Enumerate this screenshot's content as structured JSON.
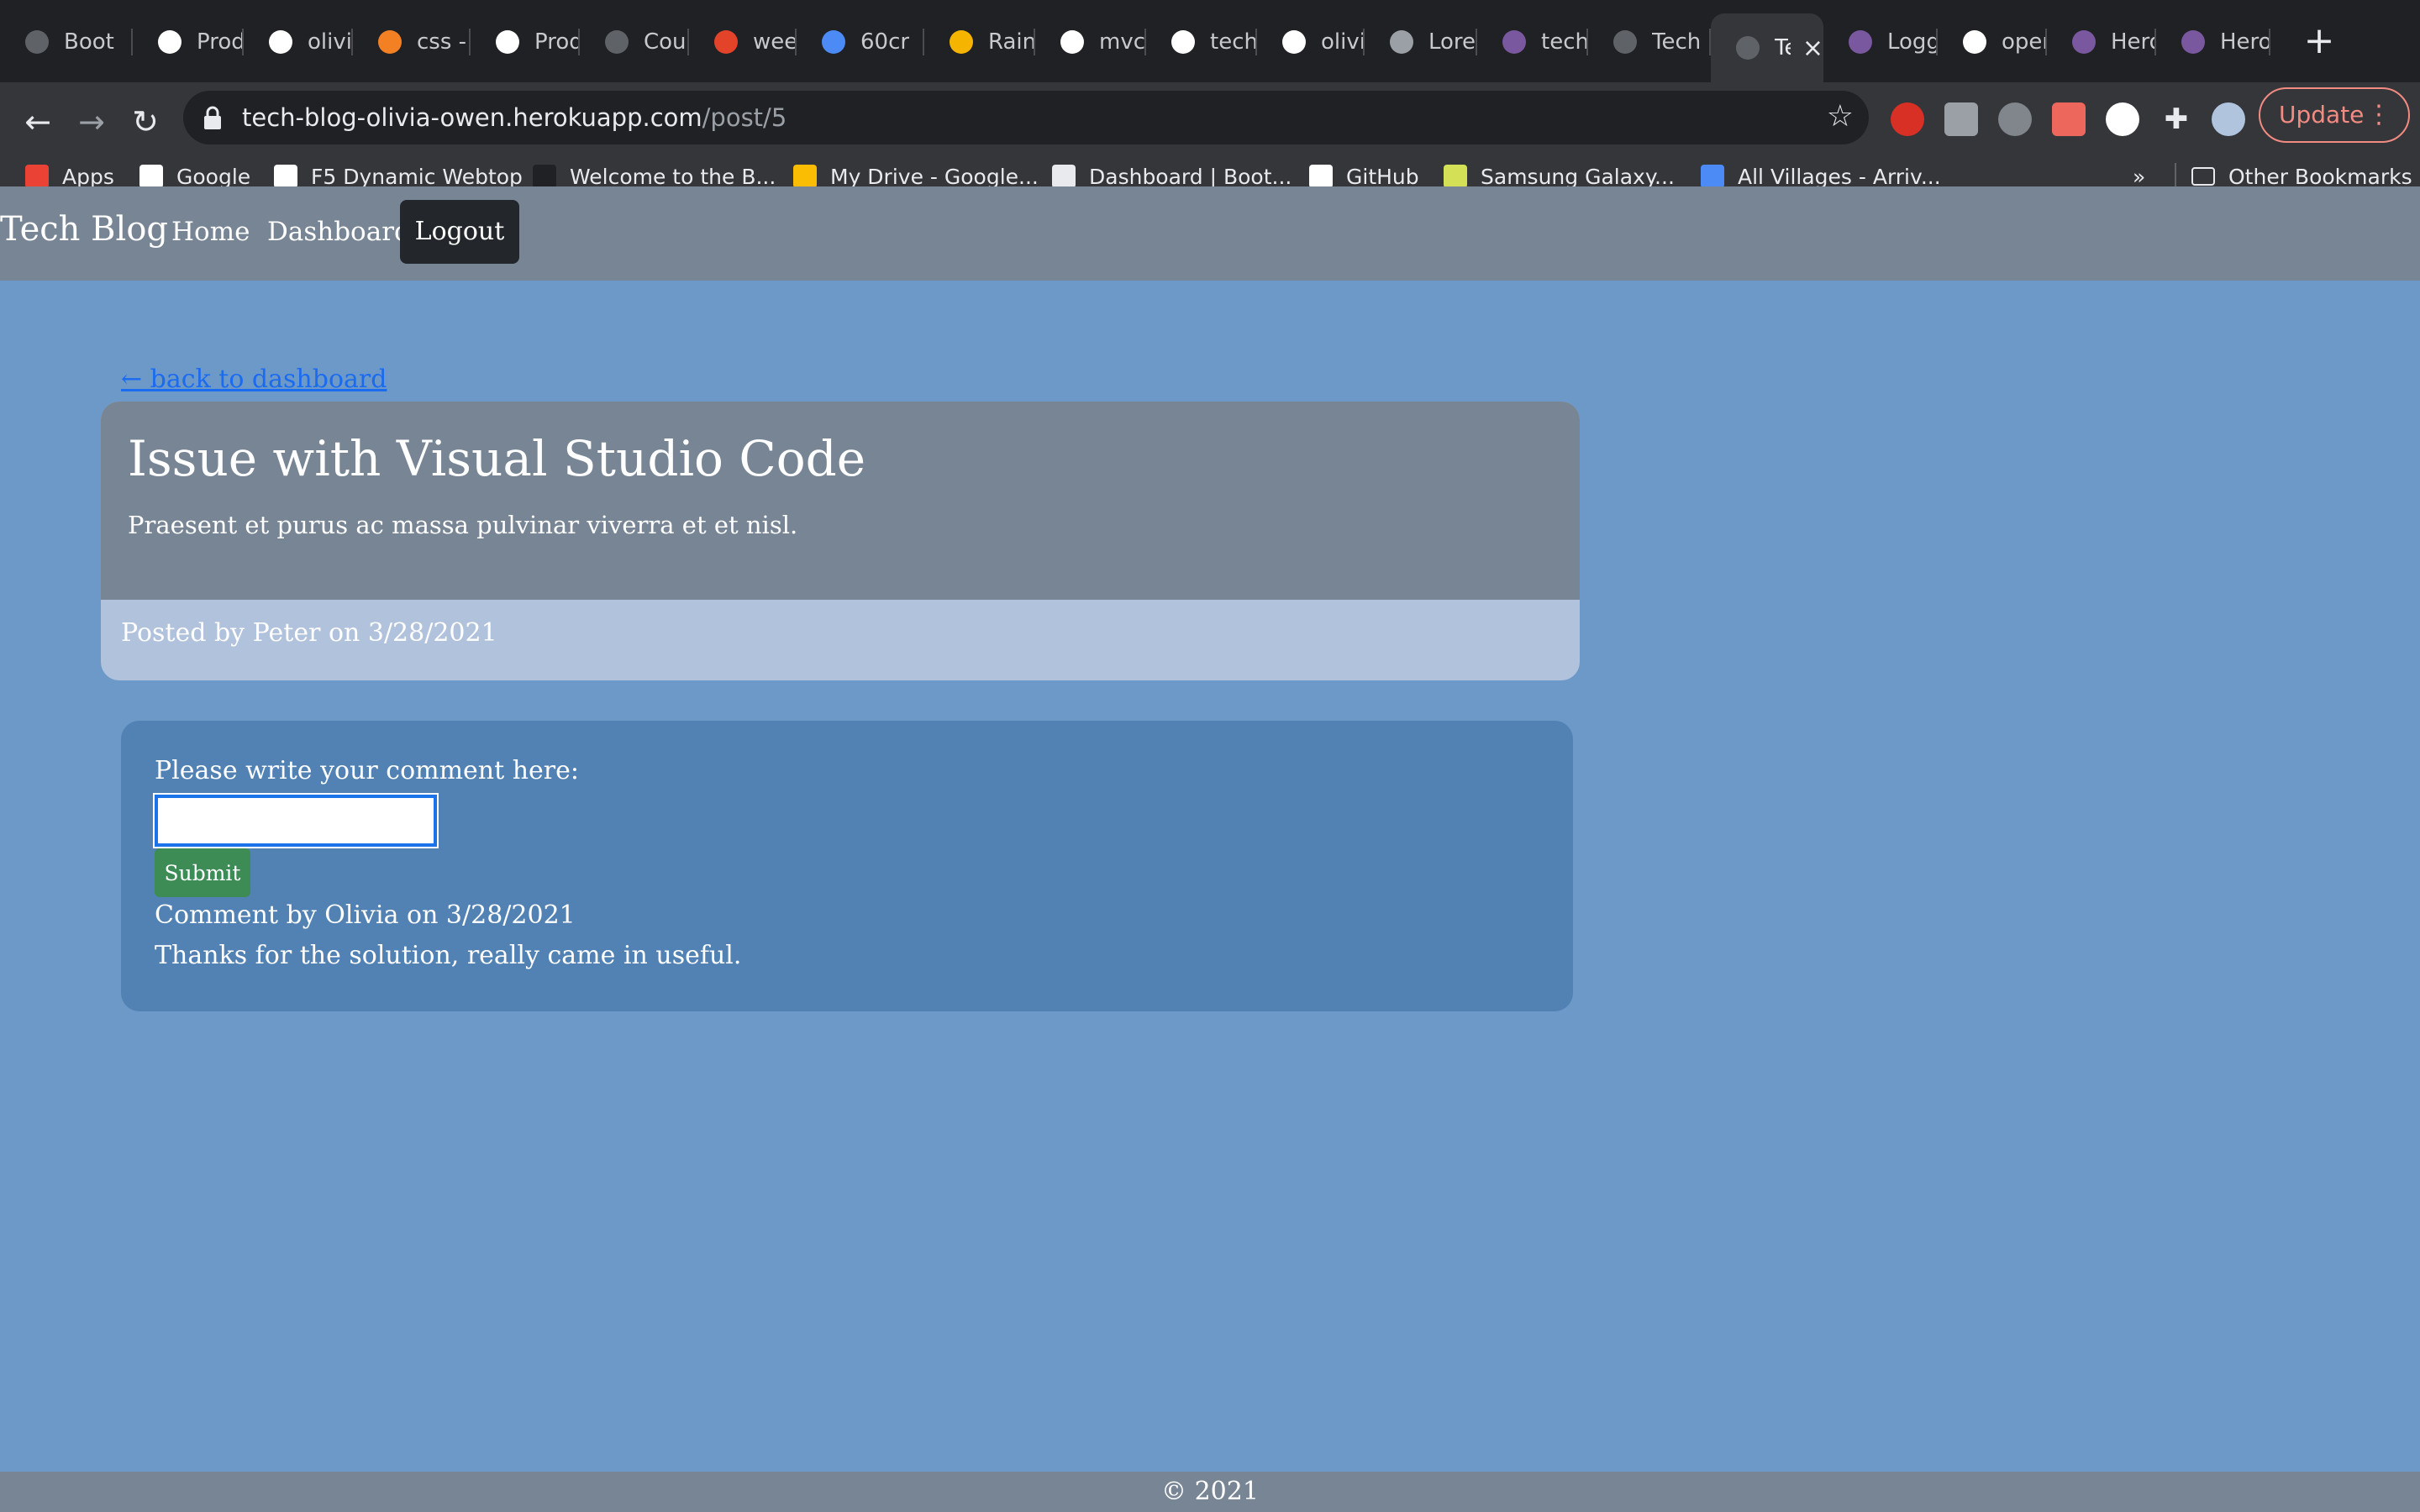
{
  "browser": {
    "tabs": [
      {
        "label": "Boot",
        "icon": "globe-icon",
        "color": "#5f6368"
      },
      {
        "label": "Prod",
        "icon": "page-icon",
        "color": "#ffffff"
      },
      {
        "label": "olivia",
        "icon": "github-icon",
        "color": "#ffffff"
      },
      {
        "label": "css -",
        "icon": "stackoverflow-icon",
        "color": "#f48024"
      },
      {
        "label": "Prod",
        "icon": "page-icon",
        "color": "#ffffff"
      },
      {
        "label": "Cour",
        "icon": "globe-icon",
        "color": "#5f6368"
      },
      {
        "label": "week",
        "icon": "gitlab-icon",
        "color": "#e24329"
      },
      {
        "label": "60cr",
        "icon": "on-icon",
        "color": "#4c8bf5"
      },
      {
        "label": "Rain",
        "icon": "rainbow-icon",
        "color": "#f4b400"
      },
      {
        "label": "mvc-",
        "icon": "github-icon",
        "color": "#ffffff"
      },
      {
        "label": "tech",
        "icon": "github-icon",
        "color": "#ffffff"
      },
      {
        "label": "olivia",
        "icon": "github-icon",
        "color": "#ffffff"
      },
      {
        "label": "Lore",
        "icon": "lorem-icon",
        "color": "#9aa0a6"
      },
      {
        "label": "tech",
        "icon": "heroku-icon",
        "color": "#79589f"
      },
      {
        "label": "Tech",
        "icon": "globe-icon",
        "color": "#5f6368"
      },
      {
        "label": "Te",
        "icon": "globe-icon",
        "color": "#5f6368",
        "active": true
      },
      {
        "label": "Logg",
        "icon": "heroku-icon",
        "color": "#79589f"
      },
      {
        "label": "open",
        "icon": "google-icon",
        "color": "#ffffff"
      },
      {
        "label": "Hero",
        "icon": "heroku-icon",
        "color": "#79589f"
      },
      {
        "label": "Hero",
        "icon": "heroku-icon",
        "color": "#79589f"
      }
    ],
    "url_host": "tech-blog-olivia-owen.herokuapp.com",
    "url_path": "/post/5",
    "update_label": "Update",
    "bookmarks": [
      {
        "label": "Apps",
        "icon": "apps-grid-icon",
        "color": "#ea4335"
      },
      {
        "label": "Google",
        "icon": "google-icon",
        "color": "#ffffff"
      },
      {
        "label": "F5 Dynamic Webtop",
        "icon": "page-icon",
        "color": "#ffffff"
      },
      {
        "label": "Welcome to the B...",
        "icon": "book-icon",
        "color": "#202124"
      },
      {
        "label": "My Drive - Google...",
        "icon": "drive-icon",
        "color": "#fbbc04"
      },
      {
        "label": "Dashboard | Boot...",
        "icon": "globe-icon",
        "color": "#e8eaed"
      },
      {
        "label": "GitHub",
        "icon": "github-icon",
        "color": "#ffffff"
      },
      {
        "label": "Samsung Galaxy...",
        "icon": "samsung-icon",
        "color": "#d4e157"
      },
      {
        "label": "All Villages - Arriv...",
        "icon": "star-outline-icon",
        "color": "#4c8bf5"
      }
    ],
    "overflow_label": "»",
    "other_bookmarks_label": "Other Bookmarks"
  },
  "site": {
    "brand": "Tech Blog",
    "nav": {
      "home": "Home",
      "dashboard": "Dashboard",
      "logout": "Logout"
    },
    "back_link": "← back to dashboard",
    "post": {
      "title": "Issue with Visual Studio Code",
      "body": "Praesent et purus ac massa pulvinar viverra et et nisl.",
      "meta": "Posted by Peter on 3/28/2021"
    },
    "comment_form": {
      "label": "Please write your comment here:",
      "input_value": "",
      "submit_label": "Submit"
    },
    "comments": [
      {
        "meta": "Comment by Olivia on 3/28/2021",
        "text": "Thanks for the solution, really came in useful."
      }
    ],
    "footer": "© 2021"
  },
  "colors": {
    "page_bg": "#6d99c8",
    "nav_bg": "#778595",
    "comment_card_bg": "#5282b3",
    "submit_bg": "#3d8b55",
    "link": "#1a6bf0"
  }
}
